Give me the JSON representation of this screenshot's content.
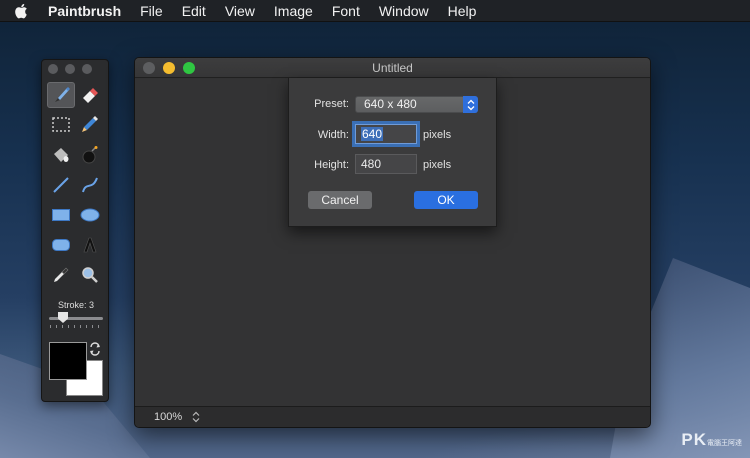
{
  "menubar": {
    "app_name": "Paintbrush",
    "items": [
      "File",
      "Edit",
      "View",
      "Image",
      "Font",
      "Window",
      "Help"
    ]
  },
  "palette": {
    "tools": [
      {
        "name": "brush-tool",
        "icon": "paintbrush-icon",
        "selected": true
      },
      {
        "name": "eraser-tool",
        "icon": "eraser-icon",
        "selected": false
      },
      {
        "name": "selection-tool",
        "icon": "marquee-selection-icon",
        "selected": false
      },
      {
        "name": "pencil-tool",
        "icon": "pencil-icon",
        "selected": false
      },
      {
        "name": "fill-tool",
        "icon": "paint-bucket-icon",
        "selected": false
      },
      {
        "name": "bomb-tool",
        "icon": "bomb-icon",
        "selected": false
      },
      {
        "name": "line-tool",
        "icon": "line-icon",
        "selected": false
      },
      {
        "name": "curve-tool",
        "icon": "curve-icon",
        "selected": false
      },
      {
        "name": "rectangle-tool",
        "icon": "rectangle-icon",
        "selected": false
      },
      {
        "name": "ellipse-tool",
        "icon": "ellipse-icon",
        "selected": false
      },
      {
        "name": "rounded-rectangle-tool",
        "icon": "rounded-rectangle-icon",
        "selected": false
      },
      {
        "name": "text-tool",
        "icon": "text-icon",
        "selected": false
      },
      {
        "name": "eyedropper-tool",
        "icon": "eyedropper-icon",
        "selected": false
      },
      {
        "name": "zoom-tool",
        "icon": "magnifier-icon",
        "selected": false
      }
    ],
    "stroke_label": "Stroke: 3",
    "stroke_value": 3,
    "foreground_color": "#000000",
    "background_color": "#ffffff"
  },
  "window": {
    "title": "Untitled",
    "zoom": "100%"
  },
  "dialog": {
    "preset_label": "Preset:",
    "preset_value": "640 x 480",
    "width_label": "Width:",
    "width_value": "640",
    "height_label": "Height:",
    "height_value": "480",
    "unit": "pixels",
    "cancel_label": "Cancel",
    "ok_label": "OK"
  },
  "watermark": {
    "text": "PK",
    "subtext": "電腦王阿達"
  },
  "colors": {
    "accent": "#2a6fe0",
    "menubar": "#1f2226",
    "window_bg": "#323233"
  }
}
